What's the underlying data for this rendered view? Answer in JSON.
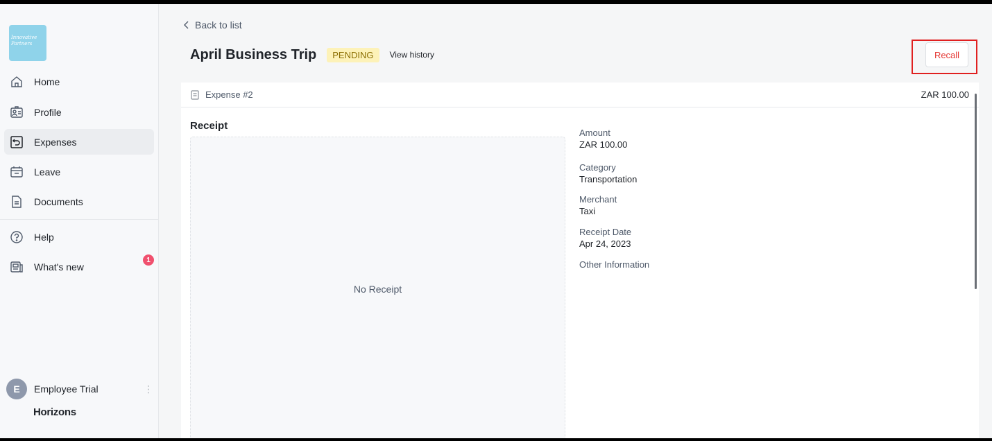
{
  "sidebar": {
    "logo_text": "Innovative Partners",
    "items": [
      {
        "label": "Home",
        "icon": "home-icon"
      },
      {
        "label": "Profile",
        "icon": "profile-icon"
      },
      {
        "label": "Expenses",
        "icon": "expenses-icon",
        "active": true
      },
      {
        "label": "Leave",
        "icon": "calendar-icon"
      },
      {
        "label": "Documents",
        "icon": "document-icon"
      },
      {
        "label": "Help",
        "icon": "help-icon"
      },
      {
        "label": "What's new",
        "icon": "news-icon",
        "badge": "1"
      }
    ],
    "user": {
      "initial": "E",
      "name": "Employee Trial"
    },
    "brand": "Horizons"
  },
  "header": {
    "back_label": "Back to list",
    "title": "April Business Trip",
    "status": "PENDING",
    "view_history": "View history",
    "recall_label": "Recall"
  },
  "expense": {
    "number": "Expense #2",
    "total": "ZAR 100.00",
    "receipt_label": "Receipt",
    "no_receipt": "No Receipt",
    "fields": [
      {
        "label": "Amount",
        "value": "ZAR 100.00"
      },
      {
        "label": "Category",
        "value": "Transportation"
      },
      {
        "label": "Merchant",
        "value": "Taxi"
      },
      {
        "label": "Receipt Date",
        "value": "Apr 24, 2023"
      },
      {
        "label": "Other Information",
        "value": ""
      }
    ]
  },
  "colors": {
    "status_bg": "#fdf2b8",
    "recall_text": "#e53935",
    "highlight": "#e02020",
    "badge": "#f0506e"
  }
}
